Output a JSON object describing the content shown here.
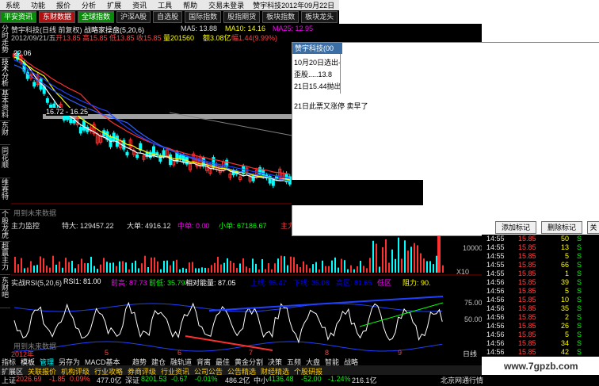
{
  "menu": {
    "items": [
      "系统",
      "功能",
      "报价",
      "分析",
      "扩展",
      "资讯",
      "工具",
      "帮助",
      "交易未登录"
    ],
    "status": "赞宇科技2012年09月22日"
  },
  "tabs": [
    {
      "label": "平安资讯",
      "style": "green"
    },
    {
      "label": "东财数据",
      "style": "red"
    },
    {
      "label": "全球指数",
      "style": "green"
    },
    {
      "label": "沪深A股",
      "style": "dark"
    },
    {
      "label": "自选股",
      "style": "dark"
    },
    {
      "label": "国际指数",
      "style": "dark"
    },
    {
      "label": "股指期货",
      "style": "dark"
    },
    {
      "label": "板块指数",
      "style": "dark"
    },
    {
      "label": "板块龙头",
      "style": "dark"
    }
  ],
  "sidebar": [
    "分时走势",
    "技术分析",
    "基本资料",
    "东财",
    "同花顺",
    "维赛特",
    "个股龙虎",
    "超赢主力",
    "东财吧"
  ],
  "chart_header": {
    "title": "赞宇科技(日线 前复权)",
    "indicator": "战略家操盘(5,20,6)",
    "ma5": "MA5: 13.88",
    "ma10": "MA10: 14.16",
    "ma25": "MA25: 12.95",
    "ma_more": "MA5",
    "date": "2012/09/21/五",
    "open": "开13.85",
    "high": "高15.85",
    "low": "低13.85",
    "close": "收15.85",
    "volume": "量201560",
    "amount": "额3.08亿",
    "change": "幅1.44(9.99%)",
    "turnover": "振2.05(14.23%)",
    "top_price": "22.06",
    "band_label": "16.72 - 16.25",
    "no_data": "用到未来数据"
  },
  "main_fund": {
    "title": "主力监控",
    "super": "特大: 129457.22",
    "big": "大单: 4916.12",
    "mid": "中单: 0.00",
    "small": "小单: 67186.67",
    "flow": "主力",
    "axis_10000": "10000",
    "axis_x10": "X10"
  },
  "rsi_panel": {
    "title": "实战RSI(5,20,6)",
    "rsi1": "RSI1: 81.00",
    "prev_high": "前高: 87.73",
    "prev_low": "前低: 35.79",
    "rel_energy": "相对能量: 87.05",
    "upper": "上线: 95.47",
    "lower": "下线: 35.06",
    "high_zone": "高区: 81.65",
    "low_zone": "低区",
    "resist": "阻力: 90.",
    "axis": [
      "75.00",
      "50.00"
    ],
    "no_data": "用到未来数据"
  },
  "timeline": {
    "year": "2012年",
    "months": [
      "5",
      "6",
      "7",
      "8",
      "9"
    ],
    "daily": "日线"
  },
  "bottom_tabs": [
    "指标",
    "模板",
    "管理",
    "另存为",
    "MACD基本",
    "趋势",
    "建仓",
    "融轨道",
    "背离",
    "最佳",
    "黄金分割",
    "决策",
    "五频",
    "大盘",
    "智能",
    "战略"
  ],
  "bottom_tabs2": [
    "扩展区",
    "关联报价",
    "机构评级",
    "行业攻略",
    "券商评级",
    "行业资讯",
    "公司公告",
    "公告精选",
    "财经精选",
    "个股研报"
  ],
  "statusbar": {
    "sh_label": "上证",
    "sh_value": "2026.69",
    "sh_change": "-1.85",
    "sh_pct": "0.09%",
    "sh_amount": "477.0亿",
    "sz_label": "深证",
    "sz_value": "8201.53",
    "sz_change": "-0.67",
    "sz_pct": "-0.01%",
    "sz_amount": "486.2亿",
    "zx_label": "中小",
    "zx_value": "4136.48",
    "zx_change": "-52.00",
    "zx_pct": "-1.24%",
    "zx_amount": "216.1亿",
    "server": "北京网通行情"
  },
  "dialog": {
    "title": "赞宇科技(00",
    "lines": [
      "10月20日选出-",
      "歪股.....13.8",
      "21日15.44抛出",
      "21日此票又涨停 卖早了"
    ],
    "btn_add": "添加标记",
    "btn_delete": "删除标记",
    "btn_more": "关"
  },
  "ticks": {
    "rows": [
      {
        "time": "14:55",
        "price": "15.85",
        "vol": "50",
        "side": "S"
      },
      {
        "time": "14:55",
        "price": "15.85",
        "vol": "13",
        "side": "S"
      },
      {
        "time": "14:55",
        "price": "15.85",
        "vol": "5",
        "side": "S"
      },
      {
        "time": "14:55",
        "price": "15.85",
        "vol": "66",
        "side": "S"
      },
      {
        "time": "14:55",
        "price": "15.85",
        "vol": "1",
        "side": "S"
      },
      {
        "time": "14:56",
        "price": "15.85",
        "vol": "39",
        "side": "S"
      },
      {
        "time": "14:56",
        "price": "15.85",
        "vol": "5",
        "side": "S"
      },
      {
        "time": "14:56",
        "price": "15.85",
        "vol": "10",
        "side": "S"
      },
      {
        "time": "14:56",
        "price": "15.85",
        "vol": "35",
        "side": "S"
      },
      {
        "time": "14:56",
        "price": "15.85",
        "vol": "2",
        "side": "S"
      },
      {
        "time": "14:56",
        "price": "15.85",
        "vol": "26",
        "side": "S"
      },
      {
        "time": "14:56",
        "price": "15.85",
        "vol": "5",
        "side": "S"
      },
      {
        "time": "14:56",
        "price": "15.85",
        "vol": "34",
        "side": "S"
      },
      {
        "time": "14:56",
        "price": "15.85",
        "vol": "42",
        "side": "S"
      }
    ],
    "price_color": "#ff4040",
    "vol_color": "#ffff00",
    "side_color": "#00ff00"
  },
  "watermark": "www.7gpzb.com",
  "colors": {
    "up": "#ff3030",
    "down": "#00ffff",
    "ma5": "#ffffff",
    "ma10": "#ffff00",
    "ma25": "#ff00ff",
    "accent": "#3a6ea5"
  }
}
